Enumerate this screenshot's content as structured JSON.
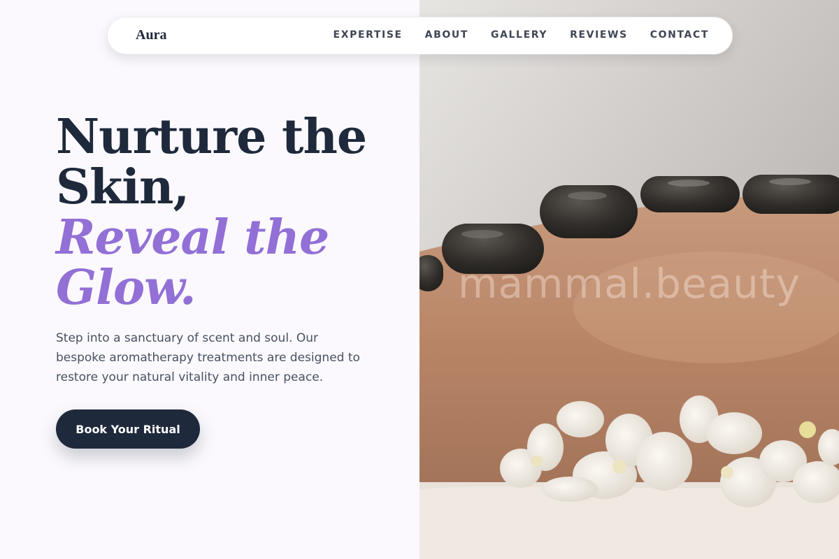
{
  "nav": {
    "brand": "Aura",
    "links": [
      "EXPERTISE",
      "ABOUT",
      "GALLERY",
      "REVIEWS",
      "CONTACT"
    ]
  },
  "hero": {
    "headline_line1": "Nurture the",
    "headline_line2": "Skin,",
    "accent_line1": "Reveal the",
    "accent_line2": "Glow.",
    "description": "Step into a sanctuary of scent and soul. Our bespoke aromatherapy treatments are designed to restore your natural vitality and inner peace.",
    "cta_label": "Book Your Ritual"
  },
  "image": {
    "watermark": "mammal.beauty"
  },
  "colors": {
    "primary": "#1e293b",
    "accent": "#9270d6",
    "background": "#fbf9fd"
  }
}
